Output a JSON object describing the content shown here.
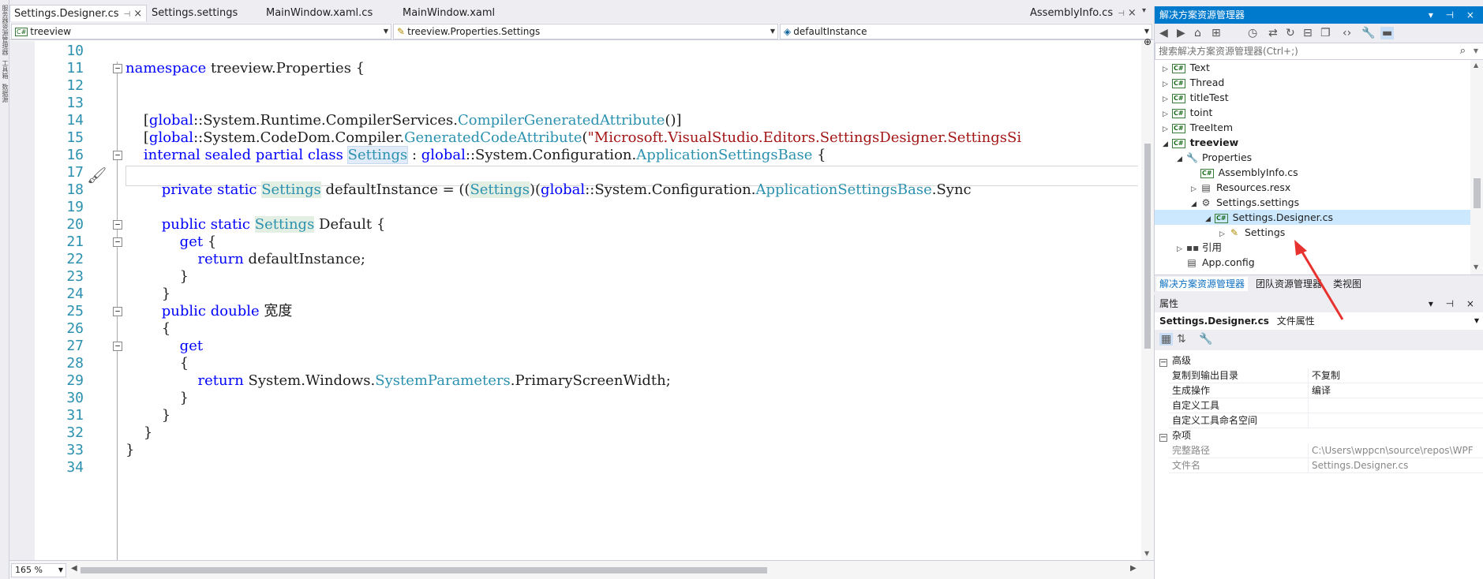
{
  "tabs": [
    {
      "label": "Settings.Designer.cs",
      "active": true
    },
    {
      "label": "Settings.settings"
    },
    {
      "label": "MainWindow.xaml.cs"
    },
    {
      "label": "MainWindow.xaml"
    },
    {
      "label": "AssemblyInfo.cs"
    }
  ],
  "navbar": {
    "project": "treeview",
    "type": "treeview.Properties.Settings",
    "member": "defaultInstance"
  },
  "code_lines": [
    {
      "n": "10",
      "html": ""
    },
    {
      "n": "11",
      "html": "<span class='kw'>namespace</span> treeview.Properties {"
    },
    {
      "n": "12",
      "html": ""
    },
    {
      "n": "13",
      "html": ""
    },
    {
      "n": "14",
      "html": "    [<span class='kw'>global</span>::System.Runtime.CompilerServices.<span class='ty'>CompilerGeneratedAttribute</span>()]"
    },
    {
      "n": "15",
      "html": "    [<span class='kw'>global</span>::System.CodeDom.Compiler.<span class='ty'>GeneratedCodeAttribute</span>(<span class='st'>\"Microsoft.VisualStudio.Editors.SettingsDesigner.SettingsSi</span>"
    },
    {
      "n": "16",
      "html": "    <span class='kw'>internal sealed partial class</span> <span class='hl'>Settings</span> : <span class='kw'>global</span>::System.Configuration.<span class='ty'>ApplicationSettingsBase</span> {"
    },
    {
      "n": "17",
      "html": ""
    },
    {
      "n": "18",
      "html": "        <span class='kw'>private static</span> <span class='hl2'>Settings</span> defaultInstance = ((<span class='hl2'>Settings</span>)(<span class='kw'>global</span>::System.Configuration.<span class='ty'>ApplicationSettingsBase</span>.Sync"
    },
    {
      "n": "19",
      "html": ""
    },
    {
      "n": "20",
      "html": "        <span class='kw'>public static</span> <span class='hl2'>Settings</span> Default {"
    },
    {
      "n": "21",
      "html": "            <span class='kw'>get</span> {"
    },
    {
      "n": "22",
      "html": "                <span class='kw'>return</span> defaultInstance;"
    },
    {
      "n": "23",
      "html": "            }"
    },
    {
      "n": "24",
      "html": "        }"
    },
    {
      "n": "25",
      "html": "        <span class='kw'>public double</span> 宽度"
    },
    {
      "n": "26",
      "html": "        {"
    },
    {
      "n": "27",
      "html": "            <span class='kw'>get</span>"
    },
    {
      "n": "28",
      "html": "            {"
    },
    {
      "n": "29",
      "html": "                <span class='kw'>return</span> System.Windows.<span class='ty'>SystemParameters</span>.PrimaryScreenWidth;"
    },
    {
      "n": "30",
      "html": "            }"
    },
    {
      "n": "31",
      "html": "        }"
    },
    {
      "n": "32",
      "html": "    }"
    },
    {
      "n": "33",
      "html": "}"
    },
    {
      "n": "34",
      "html": ""
    }
  ],
  "zoom": "165 %",
  "solution_explorer": {
    "title": "解决方案资源管理器",
    "search_placeholder": "搜索解决方案资源管理器(Ctrl+;)",
    "items": [
      {
        "label": "Text",
        "indent": 0,
        "icon": "cs-project",
        "tri": "▷"
      },
      {
        "label": "Thread",
        "indent": 0,
        "icon": "cs-project",
        "tri": "▷"
      },
      {
        "label": "titleTest",
        "indent": 0,
        "icon": "cs-project",
        "tri": "▷"
      },
      {
        "label": "toint",
        "indent": 0,
        "icon": "cs-project",
        "tri": "▷"
      },
      {
        "label": "TreeItem",
        "indent": 0,
        "icon": "cs-project",
        "tri": "▷"
      },
      {
        "label": "treeview",
        "indent": 0,
        "icon": "cs-project",
        "tri": "◢",
        "bold": true
      },
      {
        "label": "Properties",
        "indent": 1,
        "icon": "wrench",
        "tri": "◢"
      },
      {
        "label": "AssemblyInfo.cs",
        "indent": 2,
        "icon": "cs-file",
        "tri": ""
      },
      {
        "label": "Resources.resx",
        "indent": 2,
        "icon": "resx",
        "tri": "▷"
      },
      {
        "label": "Settings.settings",
        "indent": 2,
        "icon": "gear",
        "tri": "◢"
      },
      {
        "label": "Settings.Designer.cs",
        "indent": 3,
        "icon": "cs-file",
        "tri": "◢",
        "selected": true
      },
      {
        "label": "Settings",
        "indent": 4,
        "icon": "class",
        "tri": "▷"
      },
      {
        "label": "引用",
        "indent": 1,
        "icon": "references",
        "tri": "▷"
      },
      {
        "label": "App.config",
        "indent": 1,
        "icon": "config",
        "tri": ""
      }
    ],
    "bottom_tabs": [
      "解决方案资源管理器",
      "团队资源管理器",
      "类视图"
    ]
  },
  "properties": {
    "title": "属性",
    "object": "Settings.Designer.cs",
    "object_type": "文件属性",
    "sections": [
      {
        "name": "高级",
        "rows": [
          {
            "key": "复制到输出目录",
            "value": "不复制"
          },
          {
            "key": "生成操作",
            "value": "编译"
          },
          {
            "key": "自定义工具",
            "value": ""
          },
          {
            "key": "自定义工具命名空间",
            "value": ""
          }
        ]
      },
      {
        "name": "杂项",
        "rows": [
          {
            "key": "完整路径",
            "value": "C:\\Users\\wppcn\\source\\repos\\WPF",
            "gray": true
          },
          {
            "key": "文件名",
            "value": "Settings.Designer.cs",
            "gray": true
          }
        ]
      }
    ]
  },
  "colors": {
    "accent": "#007acc",
    "keyword": "#0000ff",
    "type": "#2b91af",
    "string": "#a31515",
    "arrow": "#e8322f"
  }
}
